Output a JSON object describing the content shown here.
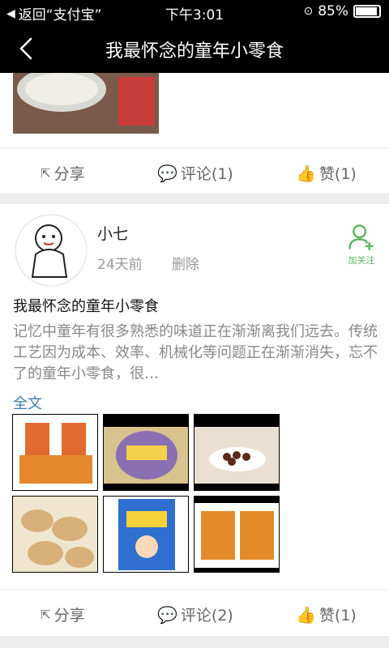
{
  "status": {
    "back_app": "返回“支付宝”",
    "time": "下午3:01",
    "battery": "85%"
  },
  "nav": {
    "title": "我最怀念的童年小零食"
  },
  "top_post": {
    "actions": {
      "share": "分享",
      "comment": "评论(1)",
      "like": "赞(1)"
    }
  },
  "post": {
    "user": "小七",
    "time_ago": "24天前",
    "delete": "删除",
    "follow": "加关注",
    "title": "我最怀念的童年小零食",
    "body": "记忆中童年有很多熟悉的味道正在渐渐离我们远去。传统工艺因为成本、效率、机械化等问题正在渐渐消失，忘不了的童年小零食，很…",
    "full_text": "全文",
    "actions": {
      "share": "分享",
      "comment": "评论(2)",
      "like": "赞(1)"
    }
  },
  "colors": {
    "accent": "#3b7fb7",
    "follow_green": "#5ab65a"
  }
}
